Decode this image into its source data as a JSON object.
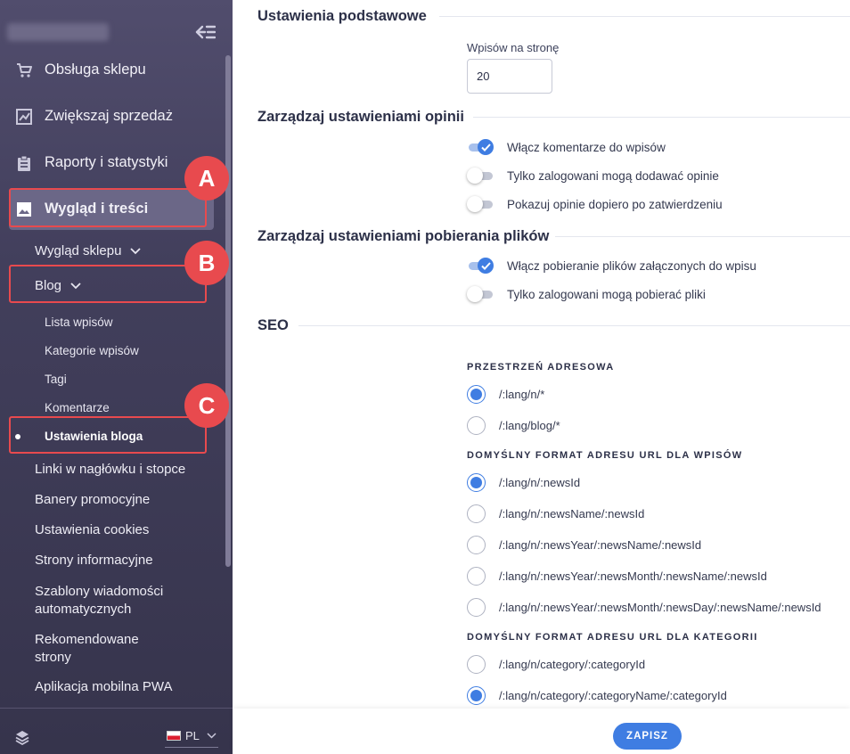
{
  "sidebar": {
    "main_items": [
      {
        "label": "Obsługa sklepu",
        "icon": "cart-icon"
      },
      {
        "label": "Zwiększaj sprzedaż",
        "icon": "chart-icon"
      },
      {
        "label": "Raporty i statystyki",
        "icon": "clipboard-icon"
      },
      {
        "label": "Wygląd i treści",
        "icon": "image-icon",
        "active": true
      }
    ],
    "sub_items": {
      "wyglad_sklepu": "Wygląd sklepu",
      "blog": "Blog",
      "blog_children": [
        "Lista wpisów",
        "Kategorie wpisów",
        "Tagi",
        "Komentarze",
        "Ustawienia bloga"
      ],
      "rest": [
        "Linki w nagłówku i stopce",
        "Banery promocyjne",
        "Ustawienia cookies",
        "Strony informacyjne",
        "Szablony wiadomości automatycznych",
        "Rekomendowane strony",
        "Aplikacja mobilna PWA"
      ]
    },
    "language": "PL",
    "markers": [
      "A",
      "B",
      "C"
    ]
  },
  "main": {
    "basic": {
      "title": "Ustawienia podstawowe",
      "posts_per_page_label": "Wpisów na stronę",
      "posts_per_page_value": "20"
    },
    "opinions": {
      "title": "Zarządzaj ustawieniami opinii",
      "toggles": [
        {
          "label": "Włącz komentarze do wpisów",
          "on": true
        },
        {
          "label": "Tylko zalogowani mogą dodawać opinie",
          "on": false
        },
        {
          "label": "Pokazuj opinie dopiero po zatwierdzeniu",
          "on": false
        }
      ]
    },
    "downloads": {
      "title": "Zarządzaj ustawieniami pobierania plików",
      "toggles": [
        {
          "label": "Włącz pobieranie plików załączonych do wpisu",
          "on": true
        },
        {
          "label": "Tylko zalogowani mogą pobierać pliki",
          "on": false
        }
      ]
    },
    "seo": {
      "title": "SEO",
      "namespace": {
        "label": "PRZESTRZEŃ ADRESOWA",
        "options": [
          "/:lang/n/*",
          "/:lang/blog/*"
        ],
        "selected": 0
      },
      "post_url": {
        "label": "DOMYŚLNY FORMAT ADRESU URL DLA WPISÓW",
        "options": [
          "/:lang/n/:newsId",
          "/:lang/n/:newsName/:newsId",
          "/:lang/n/:newsYear/:newsName/:newsId",
          "/:lang/n/:newsYear/:newsMonth/:newsName/:newsId",
          "/:lang/n/:newsYear/:newsMonth/:newsDay/:newsName/:newsId"
        ],
        "selected": 0
      },
      "category_url": {
        "label": "DOMYŚLNY FORMAT ADRESU URL DLA KATEGORII",
        "options": [
          "/:lang/n/category/:categoryId",
          "/:lang/n/category/:categoryName/:categoryId"
        ],
        "selected": 1
      }
    },
    "save_label": "ZAPISZ"
  },
  "colors": {
    "accent": "#3f7de2",
    "marker": "#e84a4e",
    "sidebar": "#423f5c"
  }
}
